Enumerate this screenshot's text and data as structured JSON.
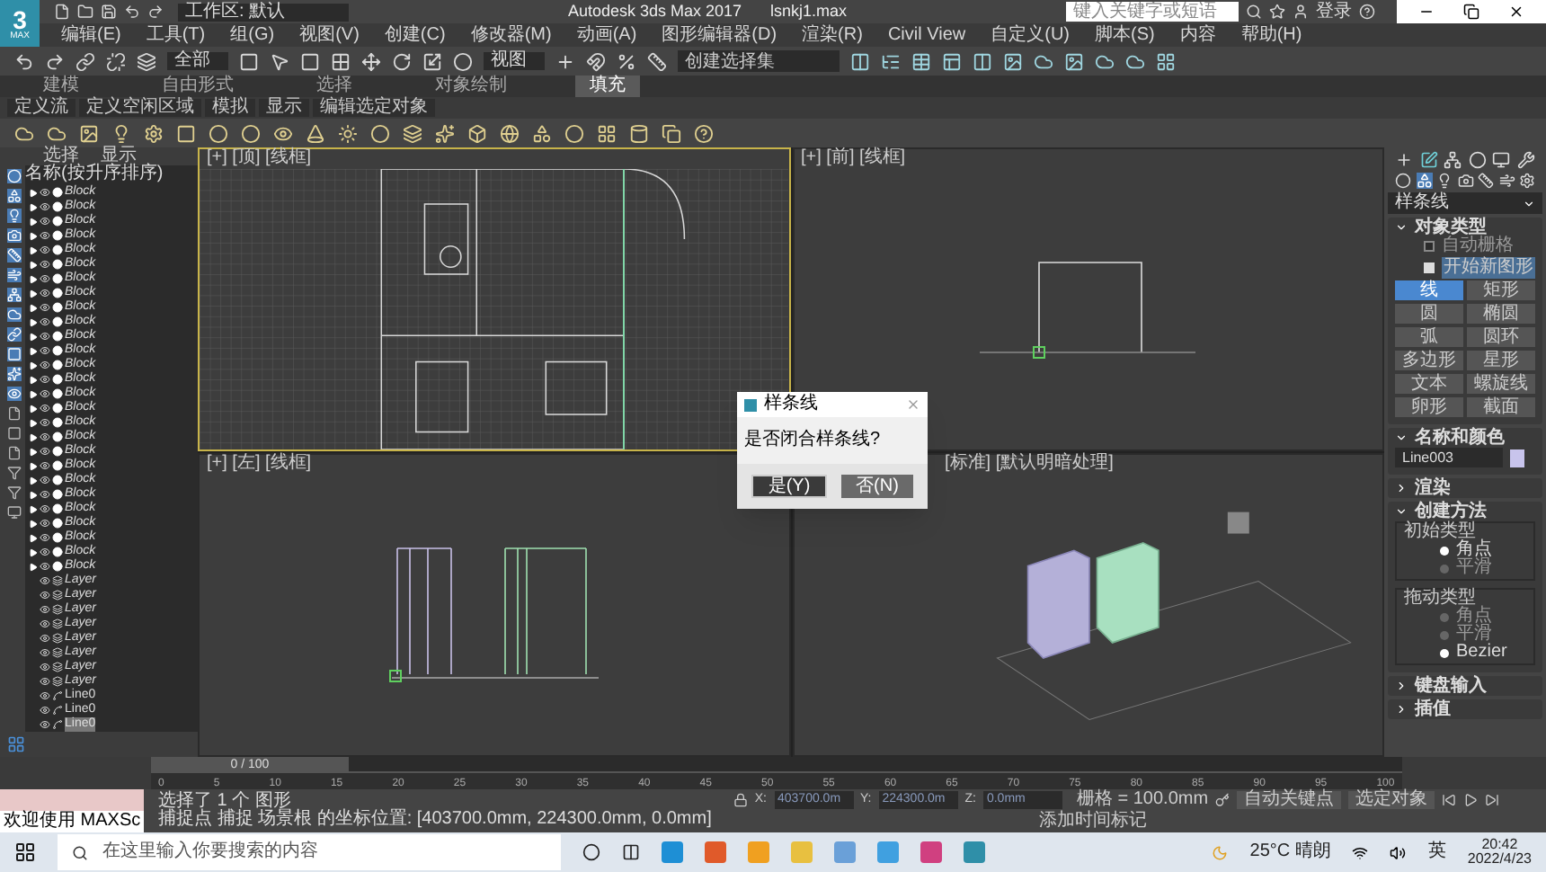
{
  "window": {
    "logo": "3",
    "logo_sub": "MAX",
    "workspace": "工作区: 默认",
    "title": "Autodesk 3ds Max 2017",
    "file": "lsnkj1.max",
    "search": {
      "placeholder": "键入关键字或短语"
    },
    "sign_in": "登录"
  },
  "menu": [
    "编辑(E)",
    "工具(T)",
    "组(G)",
    "视图(V)",
    "创建(C)",
    "修改器(M)",
    "动画(A)",
    "图形编辑器(D)",
    "渲染(R)",
    "Civil View",
    "自定义(U)",
    "脚本(S)",
    "内容",
    "帮助(H)"
  ],
  "toolbar": {
    "selection_filter": "全部",
    "coordinate_system": "视图",
    "selection_set": {
      "placeholder": "创建选择集"
    }
  },
  "ribbon": {
    "tabs": [
      {
        "label": "建模",
        "selected": false
      },
      {
        "label": "自由形式",
        "selected": false
      },
      {
        "label": "选择",
        "selected": false
      },
      {
        "label": "对象绘制",
        "selected": false
      },
      {
        "label": "填充",
        "selected": true
      }
    ],
    "sub_tabs": [
      "定义流",
      "定义空闲区域",
      "模拟",
      "显示",
      "编辑选定对象"
    ]
  },
  "scene_explorer": {
    "tabs": [
      "选择",
      "显示"
    ],
    "column": "名称(按升序排序)",
    "rows": [
      {
        "name": "Block",
        "kind": "block",
        "selected": false
      },
      {
        "name": "Block",
        "kind": "block",
        "selected": false
      },
      {
        "name": "Block",
        "kind": "block",
        "selected": false
      },
      {
        "name": "Block",
        "kind": "block",
        "selected": false
      },
      {
        "name": "Block",
        "kind": "block",
        "selected": false
      },
      {
        "name": "Block",
        "kind": "block",
        "selected": false
      },
      {
        "name": "Block",
        "kind": "block",
        "selected": false
      },
      {
        "name": "Block",
        "kind": "block",
        "selected": false
      },
      {
        "name": "Block",
        "kind": "block",
        "selected": false
      },
      {
        "name": "Block",
        "kind": "block",
        "selected": false
      },
      {
        "name": "Block",
        "kind": "block",
        "selected": false
      },
      {
        "name": "Block",
        "kind": "block",
        "selected": false
      },
      {
        "name": "Block",
        "kind": "block",
        "selected": false
      },
      {
        "name": "Block",
        "kind": "block",
        "selected": false
      },
      {
        "name": "Block",
        "kind": "block",
        "selected": false
      },
      {
        "name": "Block",
        "kind": "block",
        "selected": false
      },
      {
        "name": "Block",
        "kind": "block",
        "selected": false
      },
      {
        "name": "Block",
        "kind": "block",
        "selected": false
      },
      {
        "name": "Block",
        "kind": "block",
        "selected": false
      },
      {
        "name": "Block",
        "kind": "block",
        "selected": false
      },
      {
        "name": "Block",
        "kind": "block",
        "selected": false
      },
      {
        "name": "Block",
        "kind": "block",
        "selected": false
      },
      {
        "name": "Block",
        "kind": "block",
        "selected": false
      },
      {
        "name": "Block",
        "kind": "block",
        "selected": false
      },
      {
        "name": "Block",
        "kind": "block",
        "selected": false
      },
      {
        "name": "Block",
        "kind": "block",
        "selected": false
      },
      {
        "name": "Block",
        "kind": "block",
        "selected": false
      },
      {
        "name": "Layer",
        "kind": "layer",
        "selected": false
      },
      {
        "name": "Layer",
        "kind": "layer",
        "selected": false
      },
      {
        "name": "Layer",
        "kind": "layer",
        "selected": false
      },
      {
        "name": "Layer",
        "kind": "layer",
        "selected": false
      },
      {
        "name": "Layer",
        "kind": "layer",
        "selected": false
      },
      {
        "name": "Layer",
        "kind": "layer",
        "selected": false
      },
      {
        "name": "Layer",
        "kind": "layer",
        "selected": false
      },
      {
        "name": "Layer",
        "kind": "layer",
        "selected": false
      },
      {
        "name": "Line0",
        "kind": "line",
        "selected": false
      },
      {
        "name": "Line0",
        "kind": "line",
        "selected": false
      },
      {
        "name": "Line0",
        "kind": "line",
        "selected": true
      }
    ]
  },
  "viewports": [
    {
      "label": "[+] [顶] [线框]",
      "kind": "top",
      "active": true
    },
    {
      "label": "[+] [前] [线框]",
      "kind": "front",
      "active": false
    },
    {
      "label": "[+] [左] [线框]",
      "kind": "left",
      "active": false
    },
    {
      "label": "[标准] [默认明暗处理]",
      "kind": "perspective",
      "active": false
    }
  ],
  "dialog": {
    "title": "样条线",
    "message": "是否闭合样条线?",
    "buttons": [
      {
        "label": "是(Y)",
        "selected": true
      },
      {
        "label": "否(N)",
        "selected": false
      }
    ]
  },
  "command_panel": {
    "dropdown": "样条线",
    "object_type": {
      "title": "对象类型",
      "expanded": true,
      "auto_grid": {
        "label": "自动栅格",
        "checked": false
      },
      "start_new_shape": {
        "label": "开始新图形",
        "checked": true
      },
      "buttons": [
        {
          "label": "线",
          "selected": true
        },
        {
          "label": "矩形",
          "selected": false
        },
        {
          "label": "圆",
          "selected": false
        },
        {
          "label": "椭圆",
          "selected": false
        },
        {
          "label": "弧",
          "selected": false
        },
        {
          "label": "圆环",
          "selected": false
        },
        {
          "label": "多边形",
          "selected": false
        },
        {
          "label": "星形",
          "selected": false
        },
        {
          "label": "文本",
          "selected": false
        },
        {
          "label": "螺旋线",
          "selected": false
        },
        {
          "label": "卵形",
          "selected": false
        },
        {
          "label": "截面",
          "selected": false
        }
      ]
    },
    "name_color": {
      "title": "名称和颜色",
      "expanded": true,
      "name": "Line003",
      "color": "#c8c4ec"
    },
    "rendering": {
      "title": "渲染",
      "expanded": false
    },
    "creation_method": {
      "title": "创建方法",
      "expanded": true,
      "groups": [
        {
          "label": "初始类型",
          "options": [
            {
              "label": "角点",
              "selected": true
            },
            {
              "label": "平滑",
              "selected": false
            }
          ]
        },
        {
          "label": "拖动类型",
          "options": [
            {
              "label": "角点",
              "selected": false
            },
            {
              "label": "平滑",
              "selected": false
            },
            {
              "label": "Bezier",
              "selected": true
            }
          ]
        }
      ]
    },
    "keyboard_entry": {
      "title": "键盘输入",
      "expanded": false
    },
    "interpolation": {
      "title": "插值",
      "expanded": false
    }
  },
  "timeline": {
    "frame": "0 / 100",
    "level": 0,
    "ticks": [
      "0",
      "5",
      "10",
      "15",
      "20",
      "25",
      "30",
      "35",
      "40",
      "45",
      "50",
      "55",
      "60",
      "65",
      "70",
      "75",
      "80",
      "85",
      "90",
      "95",
      "100"
    ]
  },
  "status": {
    "maxscript": "欢迎使用 MAXSc",
    "selection": "选择了 1 个 图形",
    "prompt": "捕捉点 捕捉 场景根 的坐标位置: [403700.0mm, 224300.0mm, 0.0mm]",
    "x_label": "X:",
    "x": "403700.0m",
    "y_label": "Y:",
    "y": "224300.0m",
    "z_label": "Z:",
    "z": "0.0mm",
    "grid": "栅格 = 100.0mm",
    "add_time_tag": "添加时间标记",
    "auto_key": "自动关键点",
    "selected_objects": "选定对象"
  },
  "taskbar": {
    "search": {
      "placeholder": "在这里输入你要搜索的内容"
    },
    "weather": "25°C 晴朗",
    "ime": "英",
    "time": "20:42",
    "date": "2022/4/23"
  }
}
